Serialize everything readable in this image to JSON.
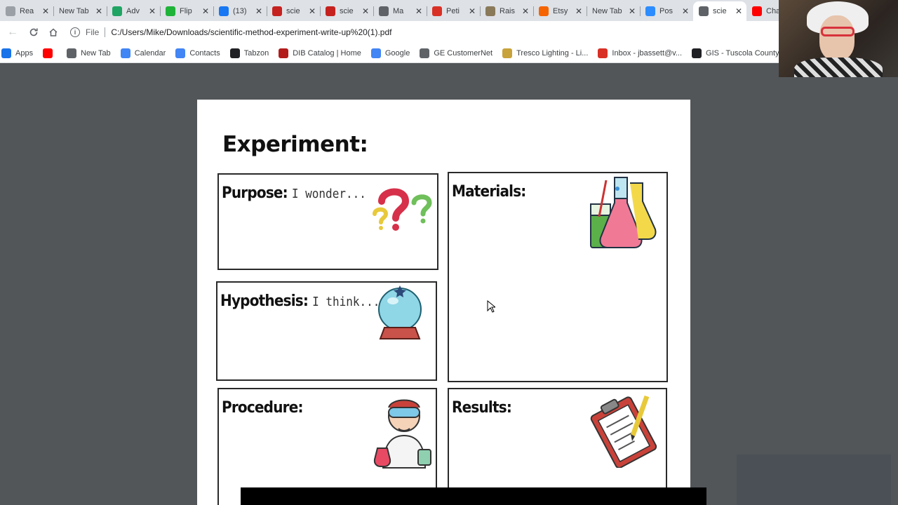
{
  "browser": {
    "tabs": [
      {
        "title": "Rea",
        "icon": "tab-favicon-page-icon",
        "color": "#9aa0a6"
      },
      {
        "title": "New Tab",
        "icon": "",
        "color": ""
      },
      {
        "title": "Adv",
        "icon": "google-drive-icon",
        "color": "#1fa463"
      },
      {
        "title": "Flip",
        "icon": "flipgrid-icon",
        "color": "#20b33a"
      },
      {
        "title": "(13)",
        "icon": "facebook-icon",
        "color": "#1877f2"
      },
      {
        "title": "scie",
        "icon": "pdf-icon",
        "color": "#c5221f"
      },
      {
        "title": "scie",
        "icon": "pdf-icon",
        "color": "#c5221f"
      },
      {
        "title": "Ma",
        "icon": "globe-icon",
        "color": "#5f6368"
      },
      {
        "title": "Peti",
        "icon": "change-org-icon",
        "color": "#d93025"
      },
      {
        "title": "Rais",
        "icon": "raise-icon",
        "color": "#8a7a5a"
      },
      {
        "title": "Etsy",
        "icon": "etsy-icon",
        "color": "#f56400"
      },
      {
        "title": "New Tab",
        "icon": "",
        "color": ""
      },
      {
        "title": "Pos",
        "icon": "zoom-icon",
        "color": "#2d8cff"
      },
      {
        "title": "scie",
        "icon": "globe-icon",
        "color": "#5f6368",
        "active": true
      },
      {
        "title": "Cha",
        "icon": "youtube-icon",
        "color": "#ff0000"
      }
    ],
    "address": {
      "scheme": "File",
      "url": "C:/Users/Mike/Downloads/scientific-method-experiment-write-up%20(1).pdf"
    },
    "bookmarks": [
      {
        "label": "Apps",
        "icon": "apps-grid-icon",
        "color": "#1a73e8"
      },
      {
        "label": "",
        "icon": "youtube-icon",
        "color": "#ff0000"
      },
      {
        "label": "New Tab",
        "icon": "globe-icon",
        "color": "#5f6368"
      },
      {
        "label": "Calendar",
        "icon": "calendar-icon",
        "color": "#4285f4"
      },
      {
        "label": "Contacts",
        "icon": "google-icon",
        "color": "#4285f4"
      },
      {
        "label": "Tabzon",
        "icon": "tabzon-icon",
        "color": "#202124"
      },
      {
        "label": "DIB Catalog | Home",
        "icon": "dib-icon",
        "color": "#b31b1b"
      },
      {
        "label": "Google",
        "icon": "google-icon",
        "color": "#4285f4"
      },
      {
        "label": "GE CustomerNet",
        "icon": "globe-icon",
        "color": "#5f6368"
      },
      {
        "label": "Tresco Lighting - Li...",
        "icon": "tresco-icon",
        "color": "#c8a23a"
      },
      {
        "label": "Inbox - jbassett@v...",
        "icon": "gmail-icon",
        "color": "#d93025"
      },
      {
        "label": "GIS - Tuscola County",
        "icon": "gis-icon",
        "color": "#202124"
      }
    ]
  },
  "document": {
    "heading": "Experiment:",
    "sections": {
      "purpose": {
        "label": "Purpose:",
        "hint": "I wonder..."
      },
      "hypothesis": {
        "label": "Hypothesis:",
        "hint": "I think..."
      },
      "materials": {
        "label": "Materials:"
      },
      "procedure": {
        "label": "Procedure:"
      },
      "results": {
        "label": "Results:"
      }
    }
  }
}
